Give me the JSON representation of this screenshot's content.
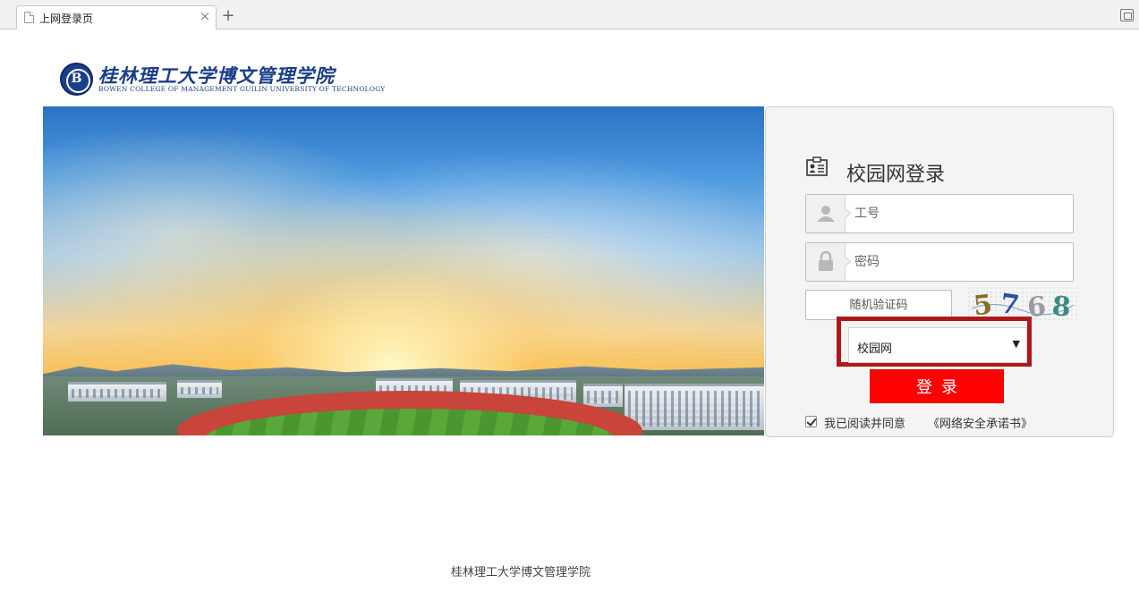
{
  "browser": {
    "tab_title": "上网登录页",
    "close_glyph": "×",
    "new_tab_glyph": "+"
  },
  "logo": {
    "name_cn": "桂林理工大学博文管理学院",
    "name_en": "BOWEN COLLEGE OF MANAGEMENT GUILIN UNIVERSITY OF TECHNOLOGY"
  },
  "login": {
    "title": "校园网登录",
    "username_placeholder": "工号",
    "password_placeholder": "密码",
    "captcha_placeholder": "随机验证码",
    "captcha_text": "5768",
    "network_select_value": "校园网",
    "network_arrow": "▼",
    "submit_label": "登录",
    "agree_checked": true,
    "agree_text": "我已阅读并同意",
    "agreement_link": "《网络安全承诺书》"
  },
  "footer": {
    "text": "桂林理工大学博文管理学院"
  },
  "colors": {
    "brand_blue": "#1a3e8a",
    "login_button": "#ff0000",
    "highlight_box": "#b01818",
    "panel_bg": "#f4f4f4"
  }
}
